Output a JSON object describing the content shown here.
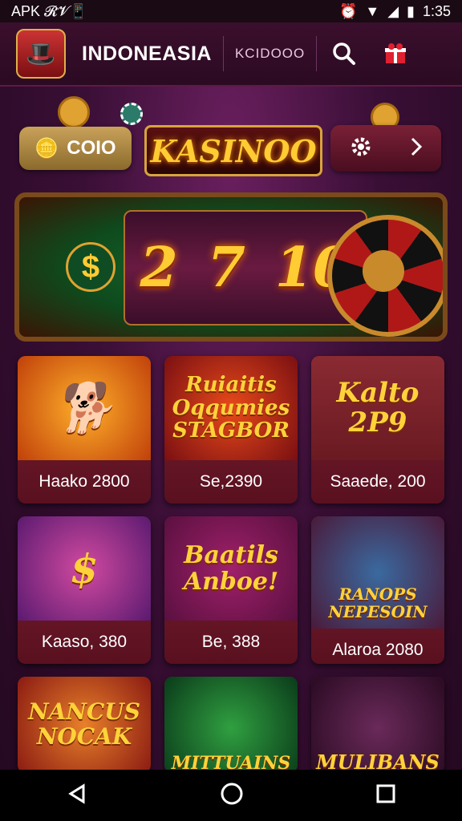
{
  "status_bar": {
    "left": "APK 𝓡𝓥📱",
    "time": "1:35"
  },
  "app": {
    "title": "INDONEASIA",
    "code": "KCIDOOO"
  },
  "header": {
    "coins_label": "COIO",
    "logo_text": "KASINOO"
  },
  "reels": {
    "digits": [
      "2",
      "7",
      "10"
    ],
    "dollar": "$"
  },
  "games": [
    {
      "art": "",
      "caption": "Haako 2800"
    },
    {
      "art": "Ruiaitis Oqqumies STAGBOR",
      "caption": "Se,2390"
    },
    {
      "art": "Kalto 2P9",
      "caption": "Saaede, 200"
    },
    {
      "art": "$",
      "caption": "Kaaso, 380"
    },
    {
      "art": "Baatils Anboe!",
      "caption": "Be, 388"
    },
    {
      "art": "RANOPS NEPESOIN",
      "caption": "Alaroa 2080"
    },
    {
      "art": "NANCUS NOCAK",
      "caption": ""
    },
    {
      "art": "MITTUAINS",
      "caption": ""
    },
    {
      "art": "MULIBANS",
      "caption": ""
    }
  ],
  "colors": {
    "accent": "#ffcc33",
    "card": "#6a1828",
    "bg": "#3a0f36"
  },
  "icons": {
    "search": "search-icon",
    "settings": "gear-icon",
    "next": "chevron-right-icon"
  }
}
